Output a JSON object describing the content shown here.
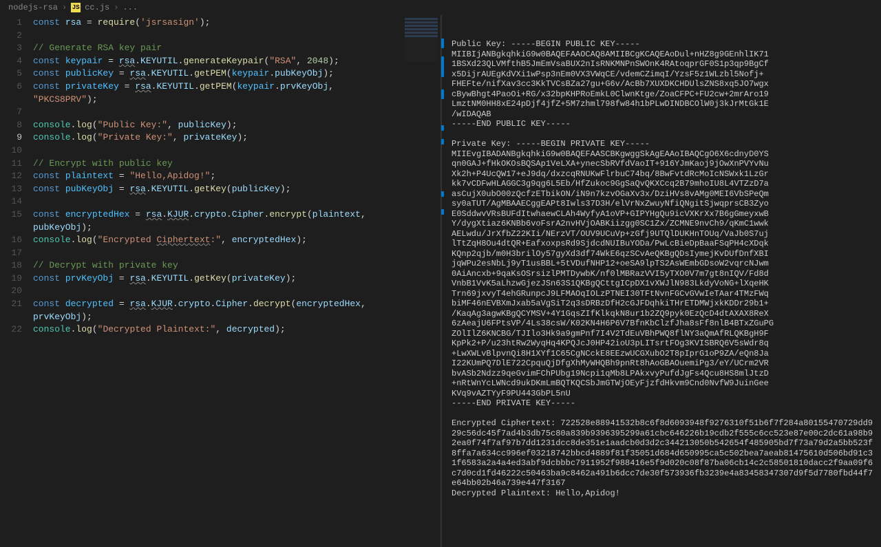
{
  "breadcrumb": {
    "folder": "nodejs-rsa",
    "file": "cc.js",
    "rest": "..."
  },
  "editor": {
    "lines": [
      {
        "n": 1,
        "segments": [
          [
            "kw",
            "const "
          ],
          [
            "var",
            "rsa"
          ],
          [
            "op",
            " = "
          ],
          [
            "fn",
            "require"
          ],
          [
            "op",
            "("
          ],
          [
            "str",
            "'jsrsasign'"
          ],
          [
            "op",
            ");"
          ]
        ]
      },
      {
        "n": 2,
        "segments": []
      },
      {
        "n": 3,
        "segments": [
          [
            "com",
            "// Generate RSA key pair"
          ]
        ]
      },
      {
        "n": 4,
        "segments": [
          [
            "kw",
            "const "
          ],
          [
            "const",
            "keypair"
          ],
          [
            "op",
            " = "
          ],
          [
            "var warn",
            "rsa"
          ],
          [
            "op",
            "."
          ],
          [
            "prop",
            "KEYUTIL"
          ],
          [
            "op",
            "."
          ],
          [
            "fn",
            "generateKeypair"
          ],
          [
            "op",
            "("
          ],
          [
            "str",
            "\"RSA\""
          ],
          [
            "op",
            ", "
          ],
          [
            "num",
            "2048"
          ],
          [
            "op",
            ");"
          ]
        ]
      },
      {
        "n": 5,
        "segments": [
          [
            "kw",
            "const "
          ],
          [
            "const",
            "publicKey"
          ],
          [
            "op",
            " = "
          ],
          [
            "var warn",
            "rsa"
          ],
          [
            "op",
            "."
          ],
          [
            "prop",
            "KEYUTIL"
          ],
          [
            "op",
            "."
          ],
          [
            "fn",
            "getPEM"
          ],
          [
            "op",
            "("
          ],
          [
            "const",
            "keypair"
          ],
          [
            "op",
            "."
          ],
          [
            "prop",
            "pubKeyObj"
          ],
          [
            "op",
            ");"
          ]
        ]
      },
      {
        "n": 6,
        "segments": [
          [
            "kw",
            "const "
          ],
          [
            "const",
            "privateKey"
          ],
          [
            "op",
            " = "
          ],
          [
            "var warn",
            "rsa"
          ],
          [
            "op",
            "."
          ],
          [
            "prop",
            "KEYUTIL"
          ],
          [
            "op",
            "."
          ],
          [
            "fn",
            "getPEM"
          ],
          [
            "op",
            "("
          ],
          [
            "const",
            "keypair"
          ],
          [
            "op",
            "."
          ],
          [
            "prop",
            "prvKeyObj"
          ],
          [
            "op",
            ","
          ]
        ]
      },
      {
        "n": 6,
        "wrap": true,
        "segments": [
          [
            "str",
            "\"PKCS8PRV\""
          ],
          [
            "op",
            ");"
          ]
        ]
      },
      {
        "n": 7,
        "segments": []
      },
      {
        "n": 8,
        "segments": [
          [
            "obj",
            "console"
          ],
          [
            "op",
            "."
          ],
          [
            "fn",
            "log"
          ],
          [
            "op",
            "("
          ],
          [
            "str",
            "\"Public Key:\""
          ],
          [
            "op",
            ", "
          ],
          [
            "var",
            "publicKey"
          ],
          [
            "op",
            ");"
          ]
        ]
      },
      {
        "n": 9,
        "active": true,
        "segments": [
          [
            "obj",
            "console"
          ],
          [
            "op",
            "."
          ],
          [
            "fn",
            "log"
          ],
          [
            "op",
            "("
          ],
          [
            "str",
            "\"Private Key:\""
          ],
          [
            "op",
            ", "
          ],
          [
            "var",
            "privateKey"
          ],
          [
            "op",
            ");"
          ]
        ]
      },
      {
        "n": 10,
        "segments": []
      },
      {
        "n": 11,
        "segments": [
          [
            "com",
            "// Encrypt with public key"
          ]
        ]
      },
      {
        "n": 12,
        "segments": [
          [
            "kw",
            "const "
          ],
          [
            "const",
            "plaintext"
          ],
          [
            "op",
            " = "
          ],
          [
            "str",
            "\"Hello,Apidog!\""
          ],
          [
            "op",
            ";"
          ]
        ]
      },
      {
        "n": 13,
        "segments": [
          [
            "kw",
            "const "
          ],
          [
            "const",
            "pubKeyObj"
          ],
          [
            "op",
            " = "
          ],
          [
            "var warn",
            "rsa"
          ],
          [
            "op",
            "."
          ],
          [
            "prop",
            "KEYUTIL"
          ],
          [
            "op",
            "."
          ],
          [
            "fn",
            "getKey"
          ],
          [
            "op",
            "("
          ],
          [
            "var",
            "publicKey"
          ],
          [
            "op",
            ");"
          ]
        ]
      },
      {
        "n": 14,
        "segments": []
      },
      {
        "n": 15,
        "segments": [
          [
            "kw",
            "const "
          ],
          [
            "const",
            "encryptedHex"
          ],
          [
            "op",
            " = "
          ],
          [
            "var warn",
            "rsa"
          ],
          [
            "op",
            "."
          ],
          [
            "prop warn",
            "KJUR"
          ],
          [
            "op",
            "."
          ],
          [
            "prop",
            "crypto"
          ],
          [
            "op",
            "."
          ],
          [
            "prop",
            "Cipher"
          ],
          [
            "op",
            "."
          ],
          [
            "fn",
            "encrypt"
          ],
          [
            "op",
            "("
          ],
          [
            "var",
            "plaintext"
          ],
          [
            "op",
            ","
          ]
        ]
      },
      {
        "n": 15,
        "wrap": true,
        "segments": [
          [
            "var",
            "pubKeyObj"
          ],
          [
            "op",
            ");"
          ]
        ]
      },
      {
        "n": 16,
        "segments": [
          [
            "obj",
            "console"
          ],
          [
            "op",
            "."
          ],
          [
            "fn",
            "log"
          ],
          [
            "op",
            "("
          ],
          [
            "str",
            "\"Encrypted "
          ],
          [
            "str warn",
            "Ciphertext"
          ],
          [
            "str",
            ":\""
          ],
          [
            "op",
            ", "
          ],
          [
            "var",
            "encryptedHex"
          ],
          [
            "op",
            ");"
          ]
        ]
      },
      {
        "n": 17,
        "segments": []
      },
      {
        "n": 18,
        "segments": [
          [
            "com",
            "// Decrypt with private key"
          ]
        ]
      },
      {
        "n": 19,
        "segments": [
          [
            "kw",
            "const "
          ],
          [
            "const",
            "prvKeyObj"
          ],
          [
            "op",
            " = "
          ],
          [
            "var warn",
            "rsa"
          ],
          [
            "op",
            "."
          ],
          [
            "prop",
            "KEYUTIL"
          ],
          [
            "op",
            "."
          ],
          [
            "fn",
            "getKey"
          ],
          [
            "op",
            "("
          ],
          [
            "var",
            "privateKey"
          ],
          [
            "op",
            ");"
          ]
        ]
      },
      {
        "n": 20,
        "segments": []
      },
      {
        "n": 21,
        "segments": [
          [
            "kw",
            "const "
          ],
          [
            "const",
            "decrypted"
          ],
          [
            "op",
            " = "
          ],
          [
            "var warn",
            "rsa"
          ],
          [
            "op",
            "."
          ],
          [
            "prop warn",
            "KJUR"
          ],
          [
            "op",
            "."
          ],
          [
            "prop",
            "crypto"
          ],
          [
            "op",
            "."
          ],
          [
            "prop",
            "Cipher"
          ],
          [
            "op",
            "."
          ],
          [
            "fn",
            "decrypt"
          ],
          [
            "op",
            "("
          ],
          [
            "var",
            "encryptedHex"
          ],
          [
            "op",
            ","
          ]
        ]
      },
      {
        "n": 21,
        "wrap": true,
        "segments": [
          [
            "var",
            "prvKeyObj"
          ],
          [
            "op",
            ");"
          ]
        ]
      },
      {
        "n": 22,
        "segments": [
          [
            "obj",
            "console"
          ],
          [
            "op",
            "."
          ],
          [
            "fn",
            "log"
          ],
          [
            "op",
            "("
          ],
          [
            "str",
            "\"Decrypted Plaintext:\""
          ],
          [
            "op",
            ", "
          ],
          [
            "var",
            "decrypted"
          ],
          [
            "op",
            ");"
          ]
        ]
      }
    ]
  },
  "output": {
    "text": "Public Key: -----BEGIN PUBLIC KEY-----\nMIIBIjANBgkqhkiG9w0BAQEFAAOCAQ8AMIIBCgKCAQEAoDul+nHZ8g9GEnhlIK71\n1BSXd23QLVMfthB5JmEmVsaBUX2nIsRNKMNPnSWOnK4RAtoqprGF0S1p3qp9BgCf\nx5DijrAUEgKdVXi1wPsp3nEm0VX3VWqCE/vdemCZimqI/YzsF5z1WLzbl5Nofj+\nFHEFte/nifXav3cc3KkTVCsBZa27gu+G6v/AcBb7XUXDKCHDUlsZNS8xq5JO7wgx\ncBywBhgt4PaoOi+RG/x32bpKHPRoEmkL0ClwnKtge/ZoaCFPC+FU2cw+2mrAro19\nLmztNM0HH8xE24pDjf4jfZ+5M7zhml798fw84h1bPLwDINDBCOlW0j3kJrMtGk1E\n/wIDAQAB\n-----END PUBLIC KEY-----\n\nPrivate Key: -----BEGIN PRIVATE KEY-----\nMIIEvgIBADANBgkqhkiG9w0BAQEFAASCBKgwggSkAgEAAoIBAQCgO6X6cdnyD0YS\nqn0GAJ+fHkOKOsBQSAp1VeLXA+ynecSbRVfdVaoIT+916YJmKaoj9jOwXnPVYvNu\nXk2h+P4UcQW17+eJ9dq/dxzcqRNUKwFlrbuC74bq/8BwFvtdRcMoIcNSWxk1LzGr\nkk7vCDFwHLAGGC3g9qg6L5Eb/HfZukoc9GgSaQvQKXCcq2B79mhoIU8L4VTZzD7a\nasCujX0ubO00zQcfzETbikON/iN9n7kzvOGaXv3x/DziHVs8vAMg0MEI6VbSPeQm\nsy0aTUT/AgMBAAECggEAPt8Iwls37D3H/elVrNxZwuyNfiQNgitSjwqprsCB3Zyo\nE0SddwvVRsBUFdItwhaewCLAh4WyfyA1oVP+GIPYHgQu9icVXKrXx7B6gGmeyxwB\nY/dygXtiaz6KNBb6voFsrA2nvHVjOABKiizgg0SC1Zx/ZCMNE9nvCh9/qKmC1wwk\nAELwdu/JrXfbZ22KIi/NErzVT/OUV9UCuVp+zGfj9UTQlDUKHnTOUq/VaJb0S7uj\nlTtZqH8Ou4dtQR+EafxoxpsRd9SjdcdNUIBuYODa/PwLcBieDpBaaFSqPH4cXDqk\nKQnp2qjb/m0H3brilOy57gyXd3df74WkE6qzSCvAeQKBgQDsIymejKvDUfDnfXBI\njqWPu2esNbLj9yT1usBBL+5tVDufNHP12+oeSA9lpTS2AsWEmbGDsoW2vqrcNJwm\n0AiAncxb+9qaKsOSrsizlPMTDywbK/nf0lMBRazVVI5yTXO0V7m7gt8nIQV/Fd8d\nVnbB1VvK5aLhzwGjezJSn63S1QKBgQCttgICpDX1vXWJlN983LkdyVoNG+lXqeHK\nTrn69jxvyT4ehGRunpcJ9LFMAOqIOLzPTNEI30TFtNvnFGCvGVwIeTAar4TMzFWq\nbiMF46nEVBXmJxab5aVgSiT2q3sDRBzDfH2cGJFDqhkiTHrETDMWjxkKDDr29b1+\n/KaqAg3agwKBgQCYMSV+4Y1GqsZIfKlkqkN8ur1b2ZQ9pyk0EzQcD4dtAXAX8ReX\n6zAeajU6FPtsVP/4Ls38csW/K02KN4H6P6V7BfnKbClzfJha8sFf8nlB4BTxZGuPG\nZOlIlZ6KNCBG/TJIlo3Hk9a9gmPnf7I4V2TdEuVBhPWQ8flNY3aQmAfRLQKBgH9F\nKpPk2+P/u23htRw2WyqHq4KPQJcJ0HP42ioU3pLITsrtFOg3KVISBRQ6V5sWdr8q\n+LwXWLvBlpvnQi8H1XYf1C65CgNCckE8EEzwUCGXubO2T8pIprG1oP9ZA/eQn8Ja\nI22KUmPQ7DlE722CpquQjDfgXhMyWHQBh9pnRt8hAoGBAOuemiPg3/eY/UCrm2VR\nbvASb2Ndzz9qeGvimFChPUbg19Ncpi1qMb8LPAkxvyPufdJgFs4Qcu8HS8mlJtzD\n+nRtWnYcLWNcd9ukDKmLmBQTKQCSbJmGTWjOEyFjzfdHkvm9Cnd0NvfW9JuinGee\nKVq9vAZTYyF9PU443GbPL5nU\n-----END PRIVATE KEY-----\n\nEncrypted Ciphertext: 722528e88941532b8c6f8d6093948f9276310f51b6f7f284a80155470729dd929c56dc45f7ad4b3db75c80a839b9396395299a61cbc646226b19cdb2f555c6cc523e87e00c2dc61a98b92ea0f74f7af97b7dd1231dcc8de351e1aadcb0d3d2c344213050b542654f485905bd7f73a79d2a5bb523f8ffa7a634cc996ef03218742bbcd4889f81f35051d684d650995ca5c502bea7aeab81475610d506bd91c31f6583a2a4a4ed3abf9dcbbbc7911952f988416e5f9d020c08f87ba06cb14c2c58501810dacc2f9aa09f6c7d0cd1fd46222c50463ba9c8462a491b6dcc7de30f573936fb3239e4a83458347307d9f5d7780fbd44f7e64bb02b46a739e447f3167\nDecrypted Plaintext: Hello,Apidog!"
  }
}
